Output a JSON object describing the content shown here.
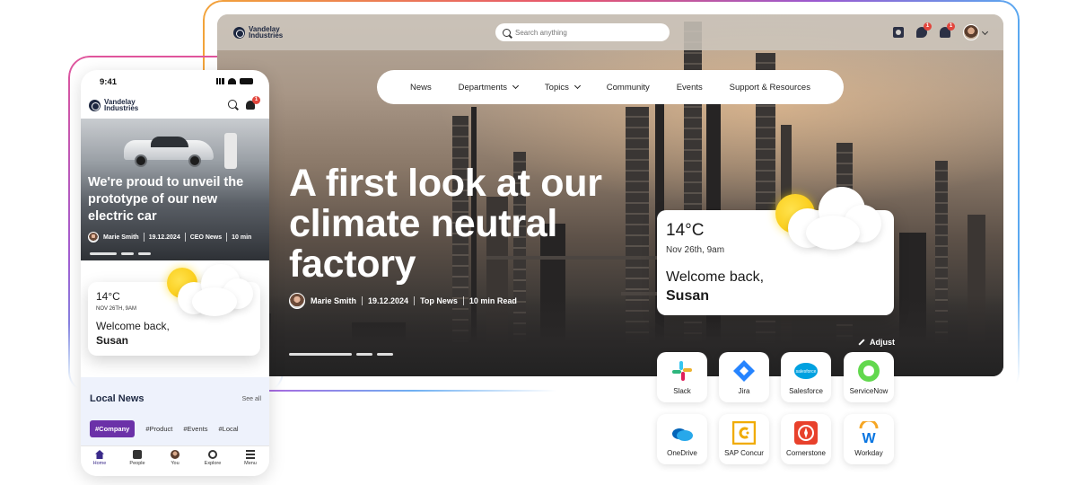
{
  "colors": {
    "brand_navy": "#1d2740",
    "accent_purple": "#6b31a8",
    "badge_red": "#e2463d",
    "sun_yellow": "#f8c300",
    "local_news_bg": "#eef2fc"
  },
  "brand": {
    "name": "Vandelay Industries"
  },
  "desktop": {
    "search": {
      "placeholder": "Search anything"
    },
    "top_icons": {
      "chat_badge": "1",
      "bell_badge": "1"
    },
    "nav": [
      "News",
      "Departments",
      "Topics",
      "Community",
      "Events",
      "Support & Resources"
    ],
    "hero": {
      "title": "A first look at our climate neutral factory",
      "author": "Marie Smith",
      "date": "19.12.2024",
      "category": "Top News",
      "read_time": "10 min Read"
    },
    "weather": {
      "temperature": "14°C",
      "datetime": "Nov 26th, 9am",
      "greeting": "Welcome back,",
      "name": "Susan"
    },
    "adjust_label": "Adjust",
    "apps": [
      {
        "label": "Slack",
        "icon": "slack-icon"
      },
      {
        "label": "Jira",
        "icon": "jira-icon"
      },
      {
        "label": "Salesforce",
        "icon": "salesforce-icon",
        "icon_text": "salesforce"
      },
      {
        "label": "ServiceNow",
        "icon": "servicenow-icon"
      },
      {
        "label": "OneDrive",
        "icon": "onedrive-icon"
      },
      {
        "label": "SAP Concur",
        "icon": "sap-concur-icon"
      },
      {
        "label": "Cornerstone",
        "icon": "cornerstone-icon"
      },
      {
        "label": "Workday",
        "icon": "workday-icon",
        "icon_text": "W"
      }
    ]
  },
  "phone": {
    "status": {
      "time": "9:41"
    },
    "notification_badge": "1",
    "hero": {
      "title": "We're proud to unveil the prototype of our new electric car",
      "author": "Marie Smith",
      "date": "19.12.2024",
      "category": "CEO News",
      "read_time": "10 min"
    },
    "weather": {
      "temperature": "14°C",
      "datetime": "NOV 26TH, 9AM",
      "greeting": "Welcome back,",
      "name": "Susan"
    },
    "local_news": {
      "title": "Local News",
      "see_all": "See all",
      "chips": [
        "#Company",
        "#Product",
        "#Events",
        "#Local"
      ]
    },
    "tabs": [
      "Home",
      "People",
      "You",
      "Explore",
      "Menu"
    ]
  }
}
